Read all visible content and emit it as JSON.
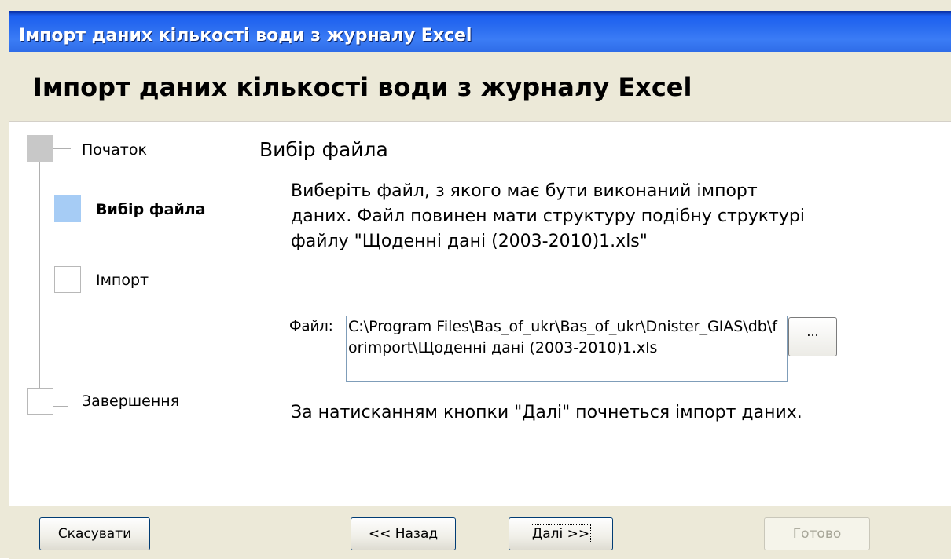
{
  "window": {
    "title": "Імпорт даних кількості води з журналу Excel",
    "header_title": "Імпорт даних кількості води з журналу Excel"
  },
  "steps": [
    {
      "label": "Початок",
      "state": "done"
    },
    {
      "label": "Вибір файла",
      "state": "active"
    },
    {
      "label": "Імпорт",
      "state": "pending"
    },
    {
      "label": "Завершення",
      "state": "pending"
    }
  ],
  "content": {
    "section_title": "Вибір файла",
    "description": "Виберіть файл, з якого має бути виконаний імпорт даних. Файл повинен мати структуру подібну структурі файлу \"Щоденні дані (2003-2010)1.xls\"",
    "file_label": "Файл:",
    "file_path": "C:\\Program Files\\Bas_of_ukr\\Bas_of_ukr\\Dnister_GIAS\\db\\forimport\\Щоденні дані (2003-2010)1.xls",
    "browse_label": "...",
    "note": "За натисканням кнопки \"Далі\" почнеться імпорт даних."
  },
  "buttons": {
    "cancel": "Скасувати",
    "back": "<< Назад",
    "next": "Далі >>",
    "finish": "Готово"
  },
  "colors": {
    "title_bar": "#2a6cf0",
    "window_bg": "#ece9d8",
    "active_step": "#a6ccf5",
    "done_step": "#c8c8c8"
  }
}
